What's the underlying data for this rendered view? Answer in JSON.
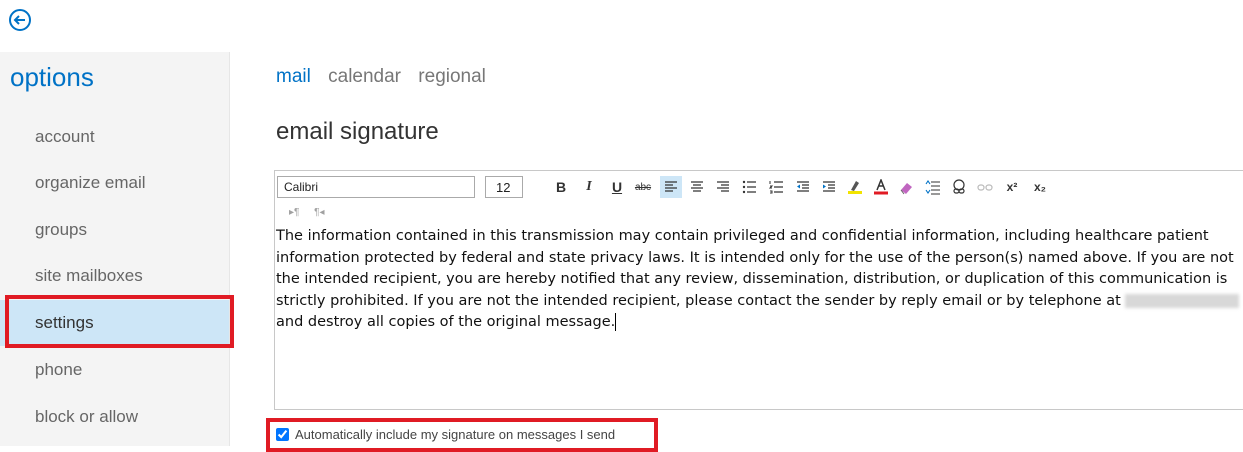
{
  "sidebar": {
    "title": "options",
    "items": [
      {
        "label": "account"
      },
      {
        "label": "organize email"
      },
      {
        "label": "groups"
      },
      {
        "label": "site mailboxes"
      },
      {
        "label": "settings"
      },
      {
        "label": "phone"
      },
      {
        "label": "block or allow"
      }
    ]
  },
  "tabs": [
    {
      "label": "mail"
    },
    {
      "label": "calendar"
    },
    {
      "label": "regional"
    }
  ],
  "section_title": "email signature",
  "toolbar": {
    "font": "Calibri",
    "size": "12",
    "bold": "B",
    "italic": "I",
    "underline": "U",
    "strikethrough": "abc",
    "superscript": "x²",
    "subscript": "x₂"
  },
  "direction": {
    "ltr": "▸¶",
    "rtl": "¶◂"
  },
  "signature": {
    "text_before": "The information contained in this transmission may contain privileged and confidential information, including healthcare patient information protected by federal and state privacy laws. It is intended only for the use of the person(s) named above. If you are not the intended recipient, you are hereby notified that any review, dissemination, distribution, or duplication of this communication is strictly prohibited. If you are not the intended recipient, please contact the sender by reply email or by telephone at",
    "text_after": " and destroy all copies of the original message."
  },
  "auto_include": {
    "label": "Automatically include my signature on messages I send",
    "checked": true
  },
  "colors": {
    "accent": "#0072c6",
    "selected_bg": "#cde6f7",
    "highlight": "#e01b24"
  }
}
